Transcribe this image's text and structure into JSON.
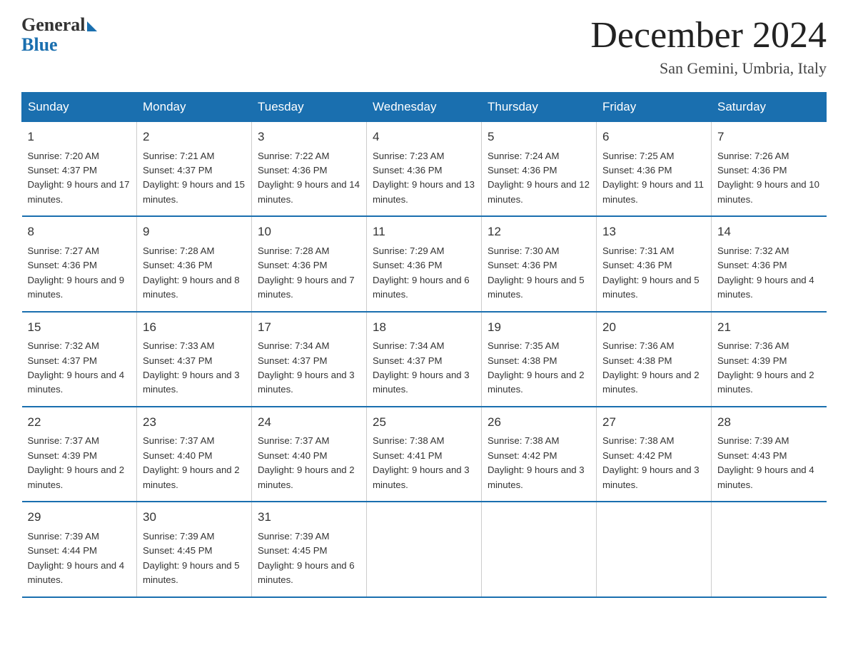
{
  "header": {
    "logo_general": "General",
    "logo_blue": "Blue",
    "month_title": "December 2024",
    "location": "San Gemini, Umbria, Italy"
  },
  "weekdays": [
    "Sunday",
    "Monday",
    "Tuesday",
    "Wednesday",
    "Thursday",
    "Friday",
    "Saturday"
  ],
  "weeks": [
    [
      {
        "day": "1",
        "sunrise": "Sunrise: 7:20 AM",
        "sunset": "Sunset: 4:37 PM",
        "daylight": "Daylight: 9 hours and 17 minutes."
      },
      {
        "day": "2",
        "sunrise": "Sunrise: 7:21 AM",
        "sunset": "Sunset: 4:37 PM",
        "daylight": "Daylight: 9 hours and 15 minutes."
      },
      {
        "day": "3",
        "sunrise": "Sunrise: 7:22 AM",
        "sunset": "Sunset: 4:36 PM",
        "daylight": "Daylight: 9 hours and 14 minutes."
      },
      {
        "day": "4",
        "sunrise": "Sunrise: 7:23 AM",
        "sunset": "Sunset: 4:36 PM",
        "daylight": "Daylight: 9 hours and 13 minutes."
      },
      {
        "day": "5",
        "sunrise": "Sunrise: 7:24 AM",
        "sunset": "Sunset: 4:36 PM",
        "daylight": "Daylight: 9 hours and 12 minutes."
      },
      {
        "day": "6",
        "sunrise": "Sunrise: 7:25 AM",
        "sunset": "Sunset: 4:36 PM",
        "daylight": "Daylight: 9 hours and 11 minutes."
      },
      {
        "day": "7",
        "sunrise": "Sunrise: 7:26 AM",
        "sunset": "Sunset: 4:36 PM",
        "daylight": "Daylight: 9 hours and 10 minutes."
      }
    ],
    [
      {
        "day": "8",
        "sunrise": "Sunrise: 7:27 AM",
        "sunset": "Sunset: 4:36 PM",
        "daylight": "Daylight: 9 hours and 9 minutes."
      },
      {
        "day": "9",
        "sunrise": "Sunrise: 7:28 AM",
        "sunset": "Sunset: 4:36 PM",
        "daylight": "Daylight: 9 hours and 8 minutes."
      },
      {
        "day": "10",
        "sunrise": "Sunrise: 7:28 AM",
        "sunset": "Sunset: 4:36 PM",
        "daylight": "Daylight: 9 hours and 7 minutes."
      },
      {
        "day": "11",
        "sunrise": "Sunrise: 7:29 AM",
        "sunset": "Sunset: 4:36 PM",
        "daylight": "Daylight: 9 hours and 6 minutes."
      },
      {
        "day": "12",
        "sunrise": "Sunrise: 7:30 AM",
        "sunset": "Sunset: 4:36 PM",
        "daylight": "Daylight: 9 hours and 5 minutes."
      },
      {
        "day": "13",
        "sunrise": "Sunrise: 7:31 AM",
        "sunset": "Sunset: 4:36 PM",
        "daylight": "Daylight: 9 hours and 5 minutes."
      },
      {
        "day": "14",
        "sunrise": "Sunrise: 7:32 AM",
        "sunset": "Sunset: 4:36 PM",
        "daylight": "Daylight: 9 hours and 4 minutes."
      }
    ],
    [
      {
        "day": "15",
        "sunrise": "Sunrise: 7:32 AM",
        "sunset": "Sunset: 4:37 PM",
        "daylight": "Daylight: 9 hours and 4 minutes."
      },
      {
        "day": "16",
        "sunrise": "Sunrise: 7:33 AM",
        "sunset": "Sunset: 4:37 PM",
        "daylight": "Daylight: 9 hours and 3 minutes."
      },
      {
        "day": "17",
        "sunrise": "Sunrise: 7:34 AM",
        "sunset": "Sunset: 4:37 PM",
        "daylight": "Daylight: 9 hours and 3 minutes."
      },
      {
        "day": "18",
        "sunrise": "Sunrise: 7:34 AM",
        "sunset": "Sunset: 4:37 PM",
        "daylight": "Daylight: 9 hours and 3 minutes."
      },
      {
        "day": "19",
        "sunrise": "Sunrise: 7:35 AM",
        "sunset": "Sunset: 4:38 PM",
        "daylight": "Daylight: 9 hours and 2 minutes."
      },
      {
        "day": "20",
        "sunrise": "Sunrise: 7:36 AM",
        "sunset": "Sunset: 4:38 PM",
        "daylight": "Daylight: 9 hours and 2 minutes."
      },
      {
        "day": "21",
        "sunrise": "Sunrise: 7:36 AM",
        "sunset": "Sunset: 4:39 PM",
        "daylight": "Daylight: 9 hours and 2 minutes."
      }
    ],
    [
      {
        "day": "22",
        "sunrise": "Sunrise: 7:37 AM",
        "sunset": "Sunset: 4:39 PM",
        "daylight": "Daylight: 9 hours and 2 minutes."
      },
      {
        "day": "23",
        "sunrise": "Sunrise: 7:37 AM",
        "sunset": "Sunset: 4:40 PM",
        "daylight": "Daylight: 9 hours and 2 minutes."
      },
      {
        "day": "24",
        "sunrise": "Sunrise: 7:37 AM",
        "sunset": "Sunset: 4:40 PM",
        "daylight": "Daylight: 9 hours and 2 minutes."
      },
      {
        "day": "25",
        "sunrise": "Sunrise: 7:38 AM",
        "sunset": "Sunset: 4:41 PM",
        "daylight": "Daylight: 9 hours and 3 minutes."
      },
      {
        "day": "26",
        "sunrise": "Sunrise: 7:38 AM",
        "sunset": "Sunset: 4:42 PM",
        "daylight": "Daylight: 9 hours and 3 minutes."
      },
      {
        "day": "27",
        "sunrise": "Sunrise: 7:38 AM",
        "sunset": "Sunset: 4:42 PM",
        "daylight": "Daylight: 9 hours and 3 minutes."
      },
      {
        "day": "28",
        "sunrise": "Sunrise: 7:39 AM",
        "sunset": "Sunset: 4:43 PM",
        "daylight": "Daylight: 9 hours and 4 minutes."
      }
    ],
    [
      {
        "day": "29",
        "sunrise": "Sunrise: 7:39 AM",
        "sunset": "Sunset: 4:44 PM",
        "daylight": "Daylight: 9 hours and 4 minutes."
      },
      {
        "day": "30",
        "sunrise": "Sunrise: 7:39 AM",
        "sunset": "Sunset: 4:45 PM",
        "daylight": "Daylight: 9 hours and 5 minutes."
      },
      {
        "day": "31",
        "sunrise": "Sunrise: 7:39 AM",
        "sunset": "Sunset: 4:45 PM",
        "daylight": "Daylight: 9 hours and 6 minutes."
      },
      {
        "day": "",
        "sunrise": "",
        "sunset": "",
        "daylight": ""
      },
      {
        "day": "",
        "sunrise": "",
        "sunset": "",
        "daylight": ""
      },
      {
        "day": "",
        "sunrise": "",
        "sunset": "",
        "daylight": ""
      },
      {
        "day": "",
        "sunrise": "",
        "sunset": "",
        "daylight": ""
      }
    ]
  ]
}
